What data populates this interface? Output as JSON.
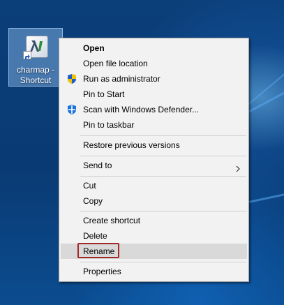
{
  "desktop": {
    "icon": {
      "label_line1": "charmap -",
      "label_line2": "Shortcut",
      "glyph": "charmap-app-icon",
      "overlay": "shortcut-arrow-icon"
    },
    "colors": {
      "wallpaper": "#0a3a73",
      "selection": "#7aaadc"
    }
  },
  "context_menu": {
    "colors": {
      "background": "#f2f2f2",
      "hover": "#d9d9d9",
      "focus_outline": "#a3282b"
    },
    "items": [
      {
        "label": "Open",
        "bold": true
      },
      {
        "label": "Open file location"
      },
      {
        "label": "Run as administrator",
        "icon": "uac-shield-icon"
      },
      {
        "label": "Pin to Start"
      },
      {
        "label": "Scan with Windows Defender...",
        "icon": "windows-defender-icon"
      },
      {
        "label": "Pin to taskbar"
      },
      {
        "label": "Restore previous versions"
      },
      {
        "label": "Send to",
        "icon": "chevron-right-icon"
      },
      {
        "label": "Cut"
      },
      {
        "label": "Copy"
      },
      {
        "label": "Create shortcut"
      },
      {
        "label": "Delete"
      },
      {
        "label": "Rename",
        "state": "highlighted"
      },
      {
        "label": "Properties"
      }
    ]
  }
}
